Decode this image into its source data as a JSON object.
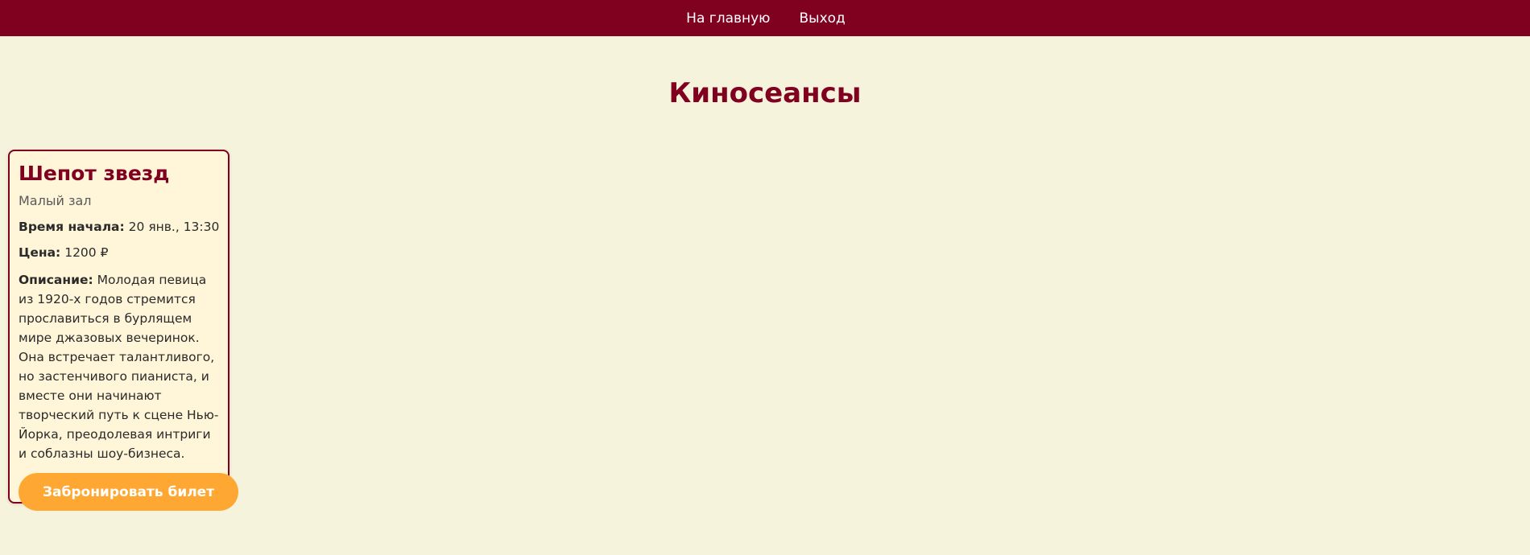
{
  "nav": {
    "home_label": "На главную",
    "logout_label": "Выход"
  },
  "page": {
    "title": "Киносеансы"
  },
  "sessions": [
    {
      "title": "Шепот звезд",
      "hall": "Малый зал",
      "start_label": "Время начала:",
      "start_value": "20 янв., 13:30",
      "price_label": "Цена:",
      "price_value": "1200 ₽",
      "description_label": "Описание:",
      "description_value": "Молодая певица из 1920-х годов стремится прославиться в бурлящем мире джазовых вечеринок. Она встречает талантливого, но застенчивого пианиста, и вместе они начинают творческий путь к сцене Нью-Йорка, преодолевая интриги и соблазны шоу-бизнеса.",
      "book_label": "Забронировать билет"
    }
  ],
  "colors": {
    "brand": "#800020",
    "background": "#f5f3dc",
    "card_background": "#fff5d9",
    "button": "#ffa733"
  }
}
